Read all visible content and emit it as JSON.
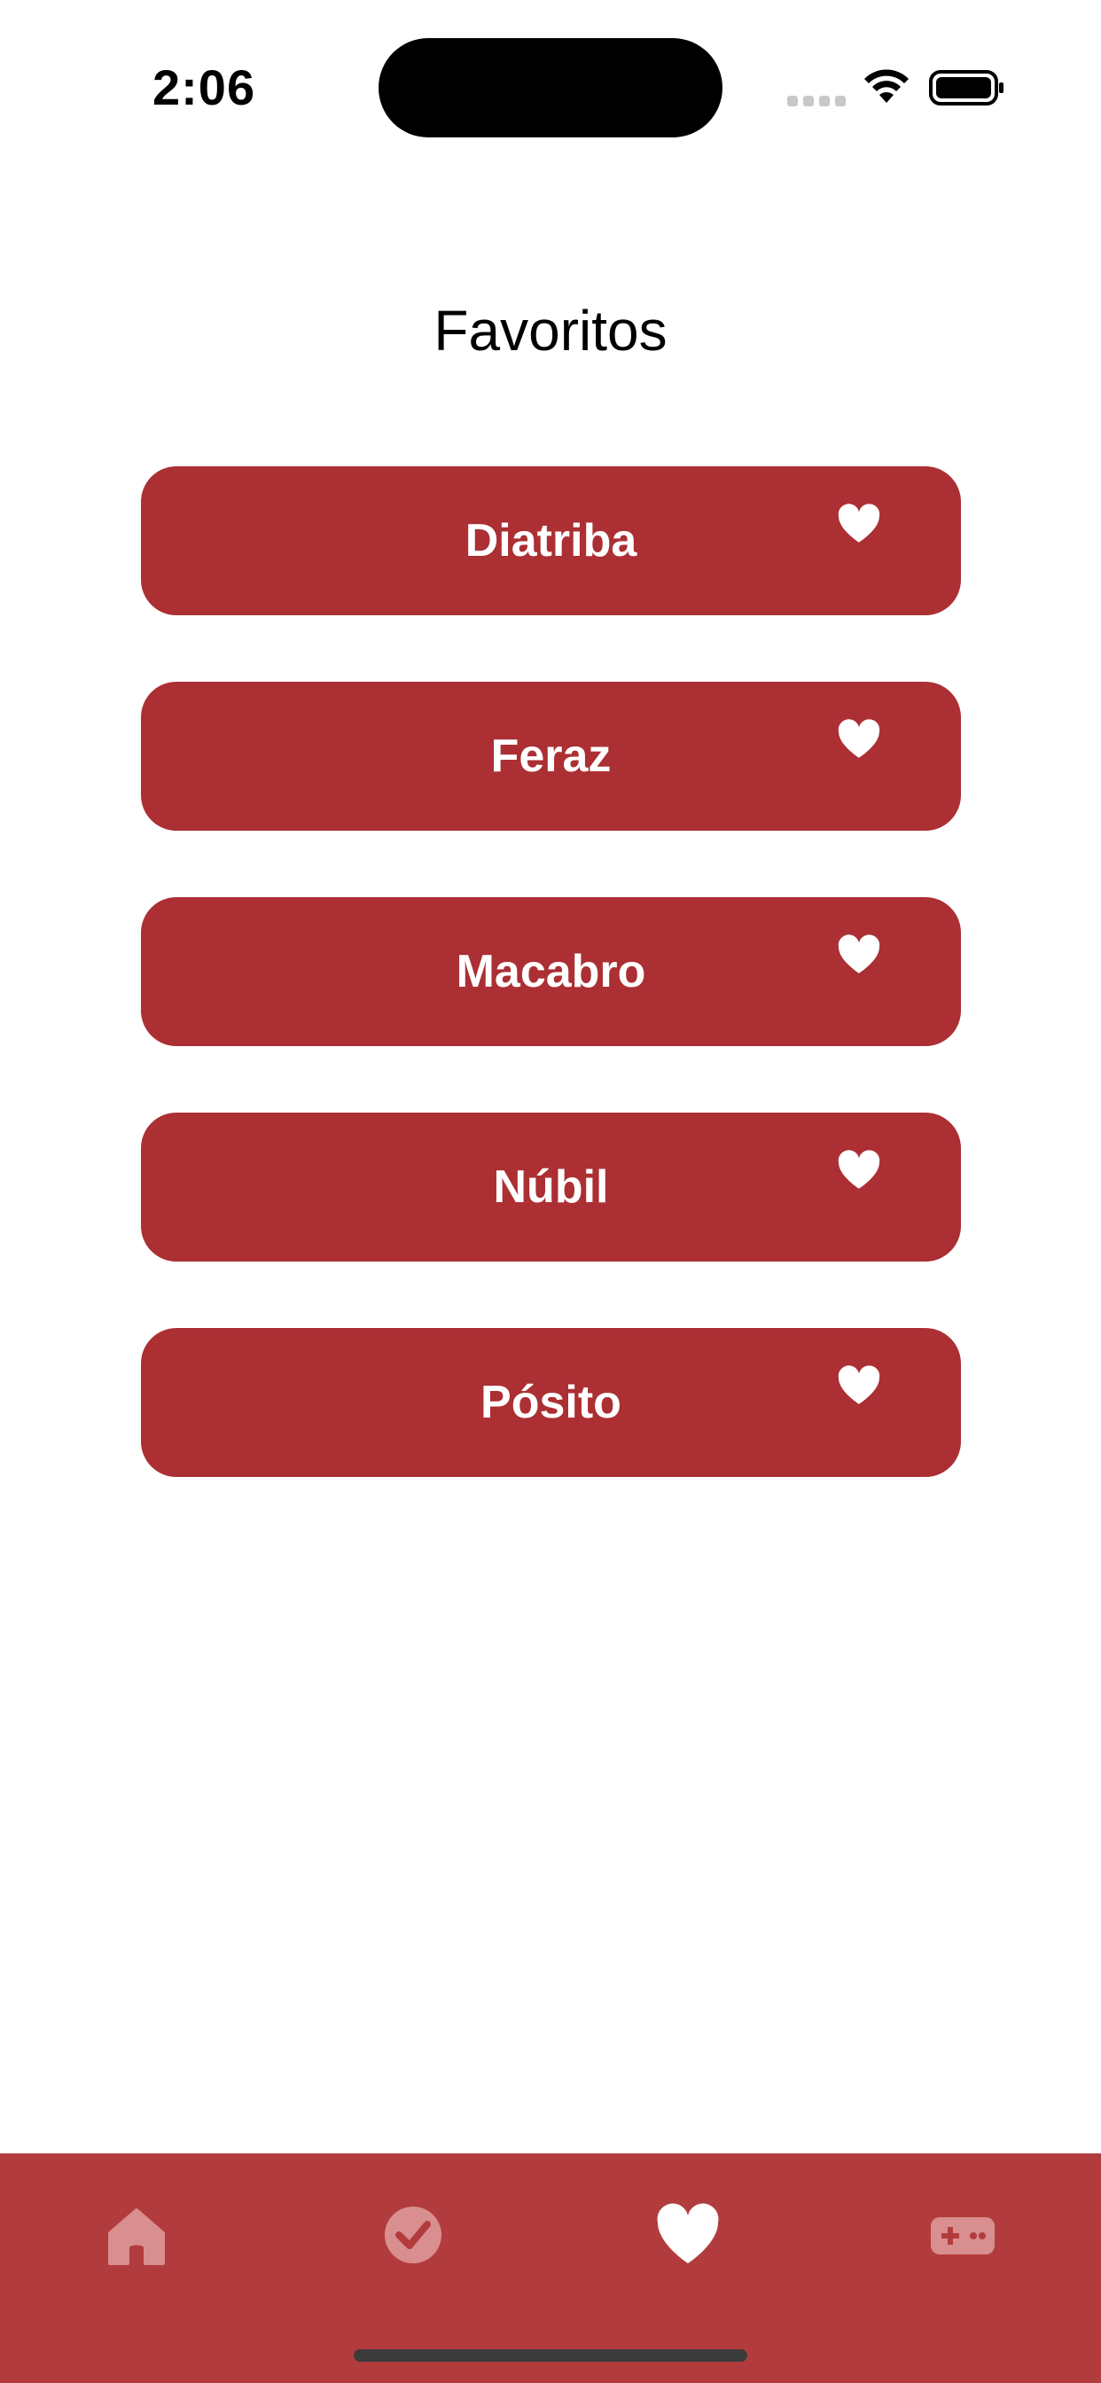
{
  "status_bar": {
    "time": "2:06",
    "icons": [
      "cellular-signal-icon",
      "wifi-icon",
      "battery-icon"
    ]
  },
  "page": {
    "title": "Favoritos"
  },
  "favorites": [
    {
      "label": "Diatriba",
      "icon": "heart-icon"
    },
    {
      "label": "Feraz",
      "icon": "heart-icon"
    },
    {
      "label": "Macabro",
      "icon": "heart-icon"
    },
    {
      "label": "Núbil",
      "icon": "heart-icon"
    },
    {
      "label": "Pósito",
      "icon": "heart-icon"
    }
  ],
  "tab_bar": {
    "tabs": [
      {
        "icon": "home-icon",
        "selected": false
      },
      {
        "icon": "checkmark-circle-icon",
        "selected": false
      },
      {
        "icon": "heart-icon",
        "selected": true
      },
      {
        "icon": "gamepad-icon",
        "selected": false
      }
    ]
  },
  "colors": {
    "card_background": "#ab2f33",
    "tab_bar_background": "#b23c3d",
    "tab_icon_selected": "#ffffff",
    "tab_icon_unselected": "#d98e8f",
    "text_on_card": "#ffffff"
  }
}
